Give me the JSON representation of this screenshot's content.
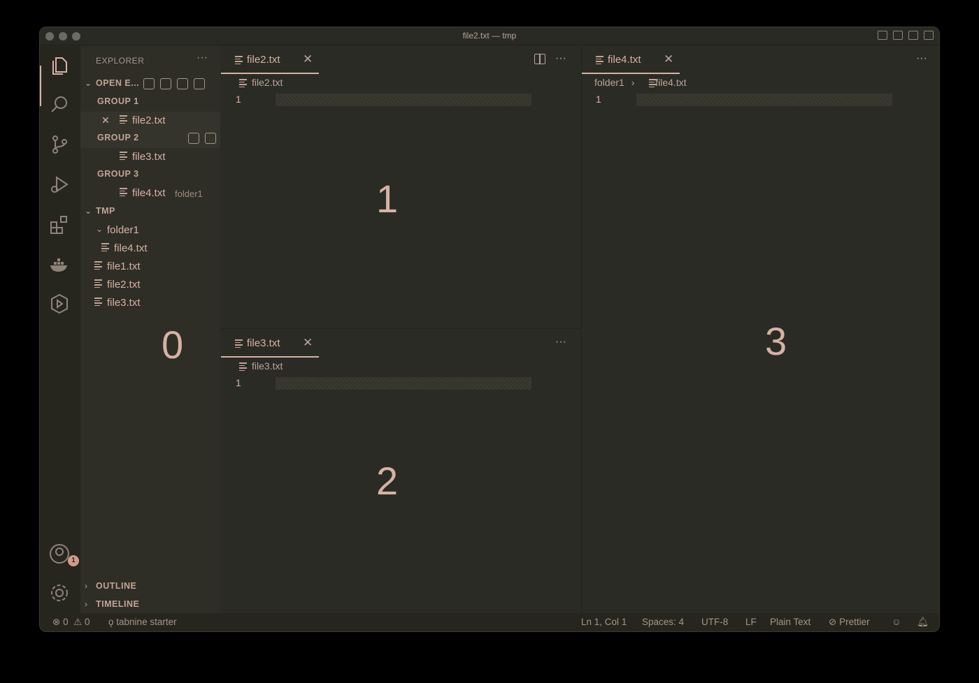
{
  "window": {
    "title": "file2.txt — tmp"
  },
  "activity": {
    "account_badge": "1"
  },
  "sidebar": {
    "header": "EXPLORER",
    "more": "···",
    "open_editors": {
      "label": "OPEN E...",
      "groups": [
        {
          "label": "GROUP 1",
          "files": [
            {
              "name": "file2.txt",
              "close": "✕"
            }
          ]
        },
        {
          "label": "GROUP 2",
          "files": [
            {
              "name": "file3.txt"
            }
          ]
        },
        {
          "label": "GROUP 3",
          "files": [
            {
              "name": "file4.txt",
              "hint": "folder1"
            }
          ]
        }
      ]
    },
    "workspace": {
      "label": "TMP",
      "folder": "folder1",
      "folder_files": [
        "file4.txt"
      ],
      "files": [
        "file1.txt",
        "file2.txt",
        "file3.txt"
      ]
    },
    "outline": "OUTLINE",
    "timeline": "TIMELINE",
    "zone_number": "0"
  },
  "editors": {
    "group1": {
      "tab": "file2.txt",
      "close": "✕",
      "crumb": "file2.txt",
      "line": "1",
      "zone_number": "1",
      "more": "···"
    },
    "group2": {
      "tab": "file3.txt",
      "close": "✕",
      "crumb": "file3.txt",
      "line": "1",
      "zone_number": "2",
      "more": "···"
    },
    "group3": {
      "tab": "file4.txt",
      "close": "✕",
      "crumb_folder": "folder1",
      "crumb_sep": "›",
      "crumb": "file4.txt",
      "line": "1",
      "zone_number": "3",
      "more": "···"
    }
  },
  "statusbar": {
    "errors": "0",
    "warnings": "0",
    "tabnine": "tabnine starter",
    "position": "Ln 1, Col 1",
    "spaces": "Spaces: 4",
    "encoding": "UTF-8",
    "eol": "LF",
    "language": "Plain Text",
    "formatter": "Prettier"
  }
}
